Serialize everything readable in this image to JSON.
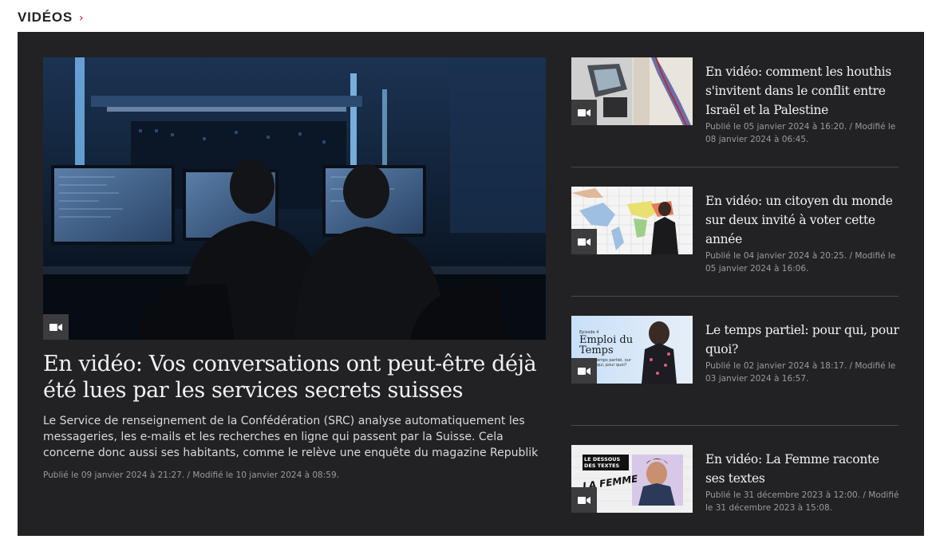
{
  "section": {
    "title": "VIDÉOS",
    "chevron_icon": "chevron-right-icon"
  },
  "colors": {
    "panel_bg": "#222224",
    "accent": "#c8102e",
    "text": "#f2f2f2",
    "meta": "#9a9a9a"
  },
  "main": {
    "title": "En vidéo: Vos conversations ont peut-être déjà été lues par les services secrets suisses",
    "description": "Le Service de renseignement de la Confédération (SRC) analyse automatiquement les messageries, les e-mails et les recherches en ligne qui passent par la Suisse. Cela concerne donc aussi ses habitants, comme le relève une enquête du magazine Republik",
    "meta": "Publié le 09 janvier 2024 à 21:27. / Modifié le 10 janvier 2024 à 08:59.",
    "icon": "video-camera-icon"
  },
  "items": [
    {
      "title": "En vidéo: comment les houthis s'invitent dans le conflit entre Israël et la Palestine",
      "meta": "Publié le 05 janvier 2024 à 16:20. / Modifié le 08 janvier 2024 à 06:45."
    },
    {
      "title": "En vidéo: un citoyen du monde sur deux invité à voter cette année",
      "meta": "Publié le 04 janvier 2024 à 20:25. / Modifié le 05 janvier 2024 à 16:06."
    },
    {
      "title": "Le temps partiel: pour qui, pour quoi?",
      "meta": "Publié le 02 janvier 2024 à 18:17. / Modifié le 03 janvier 2024 à 16:57.",
      "thumb_text": {
        "episode": "Episode 4",
        "title": "Emploi du Temps",
        "sub": "emps partiel, our qui, pour quoi?"
      }
    },
    {
      "title": "En vidéo: La Femme raconte ses textes",
      "meta": "Publié le 31 décembre 2023 à 12:00. / Modifié le 31 décembre 2023 à 15:08.",
      "thumb_text": {
        "label": "LE DESSOUS DES TEXTES",
        "name": "LA FEMME"
      }
    }
  ]
}
